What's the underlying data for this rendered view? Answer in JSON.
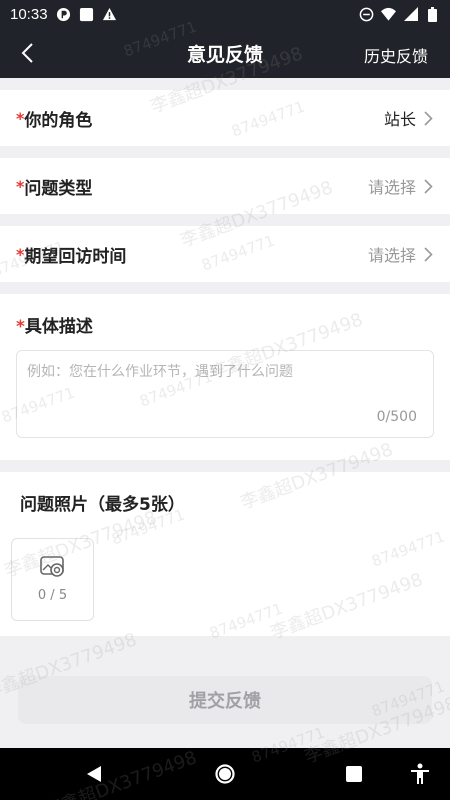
{
  "status_bar": {
    "time": "10:33",
    "icons_left": [
      "app-notification-icon",
      "square-notification-icon",
      "warning-icon"
    ],
    "icons_right": [
      "do-not-disturb-icon",
      "wifi-icon",
      "signal-icon",
      "battery-icon"
    ]
  },
  "header": {
    "title": "意见反馈",
    "history_label": "历史反馈",
    "background": "#20232a"
  },
  "form": {
    "role": {
      "required_mark": "*",
      "label": "你的角色",
      "value": "站长"
    },
    "issue_type": {
      "required_mark": "*",
      "label": "问题类型",
      "value": "请选择"
    },
    "callback_time": {
      "required_mark": "*",
      "label": "期望回访时间",
      "value": "请选择"
    },
    "description": {
      "required_mark": "*",
      "label": "具体描述",
      "placeholder": "例如：您在什么作业环节，遇到了什么问题",
      "value": "",
      "counter": "0/500"
    },
    "photos": {
      "label": "问题照片（最多5张）",
      "counter": "0 / 5"
    }
  },
  "submit": {
    "label": "提交反馈"
  },
  "watermark": {
    "id_text": "87494771",
    "name_text": "李鑫超DX3779498"
  },
  "colors": {
    "required": "#e53935",
    "page_bg": "#f0f0f2",
    "placeholder": "#999999"
  }
}
